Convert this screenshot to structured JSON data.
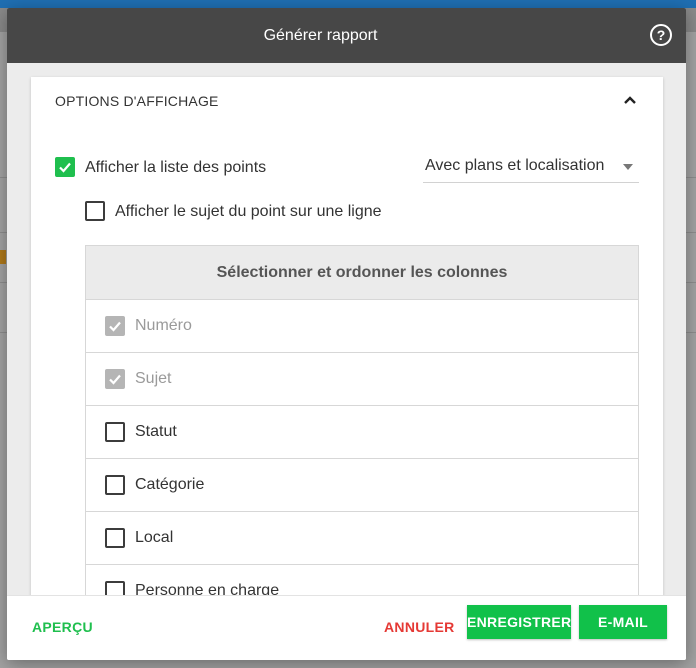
{
  "dialog": {
    "title": "Générer rapport",
    "help_icon": "help-circle-icon"
  },
  "display_options": {
    "section_title": "OPTIONS D'AFFICHAGE",
    "collapse_icon": "chevron-up-icon",
    "show_points_list": {
      "label": "Afficher la liste des points",
      "checked": true
    },
    "plans_select": {
      "value": "Avec plans et localisation"
    },
    "single_line_subject": {
      "label": "Afficher le sujet du point sur une ligne",
      "checked": false
    }
  },
  "columns": {
    "header": "Sélectionner et ordonner les colonnes",
    "items": [
      {
        "label": "Numéro",
        "checked": true,
        "disabled": true
      },
      {
        "label": "Sujet",
        "checked": true,
        "disabled": true
      },
      {
        "label": "Statut",
        "checked": false,
        "disabled": false
      },
      {
        "label": "Catégorie",
        "checked": false,
        "disabled": false
      },
      {
        "label": "Local",
        "checked": false,
        "disabled": false
      },
      {
        "label": "Personne en charge",
        "checked": false,
        "disabled": false
      }
    ]
  },
  "footer": {
    "preview_label": "APERÇU",
    "cancel_label": "ANNULER",
    "save_label": "ENREGISTRER",
    "email_label": "E-MAIL"
  },
  "colors": {
    "header_bg": "#474747",
    "accent_green": "#1fbf4e",
    "cancel_red": "#e53935"
  }
}
